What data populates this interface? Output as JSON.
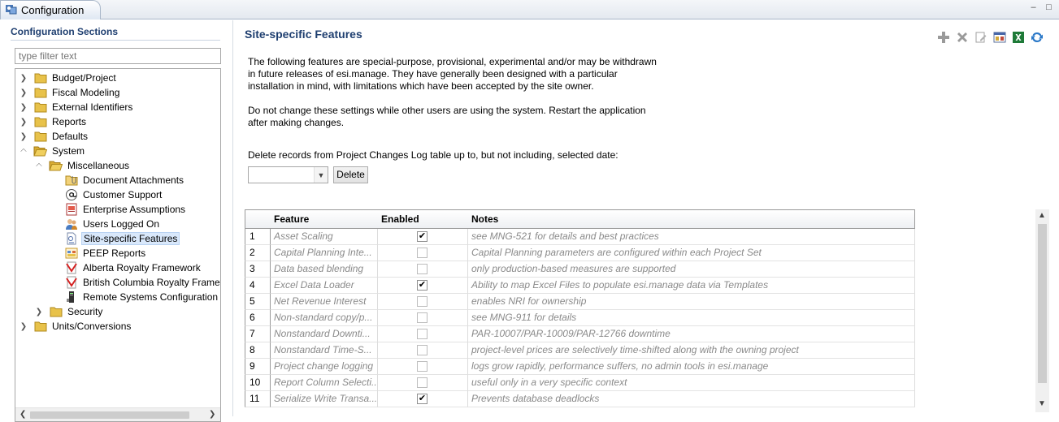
{
  "tab": {
    "title": "Configuration"
  },
  "left": {
    "section_title": "Configuration Sections",
    "filter_placeholder": "type filter text",
    "tree": [
      {
        "label": "Budget/Project",
        "icon": "folder-icon",
        "level": 0,
        "expander": "collapsed"
      },
      {
        "label": "Fiscal Modeling",
        "icon": "folder-icon",
        "level": 0,
        "expander": "collapsed"
      },
      {
        "label": "External Identifiers",
        "icon": "folder-icon",
        "level": 0,
        "expander": "collapsed"
      },
      {
        "label": "Reports",
        "icon": "folder-icon",
        "level": 0,
        "expander": "collapsed"
      },
      {
        "label": "Defaults",
        "icon": "folder-icon",
        "level": 0,
        "expander": "collapsed"
      },
      {
        "label": "System",
        "icon": "folder-open-icon",
        "level": 0,
        "expander": "expanded"
      },
      {
        "label": "Miscellaneous",
        "icon": "folder-open-icon",
        "level": 1,
        "expander": "expanded"
      },
      {
        "label": "Document Attachments",
        "icon": "attachment-folder-icon",
        "level": 2,
        "expander": "none"
      },
      {
        "label": "Customer Support",
        "icon": "at-sign-icon",
        "level": 2,
        "expander": "none"
      },
      {
        "label": "Enterprise Assumptions",
        "icon": "assumptions-icon",
        "level": 2,
        "expander": "none"
      },
      {
        "label": "Users Logged On",
        "icon": "users-icon",
        "level": 2,
        "expander": "none"
      },
      {
        "label": "Site-specific Features",
        "icon": "document-icon",
        "level": 2,
        "expander": "none",
        "selected": true
      },
      {
        "label": "PEEP Reports",
        "icon": "report-icon",
        "level": 2,
        "expander": "none"
      },
      {
        "label": "Alberta Royalty Framework",
        "icon": "royalty-icon",
        "level": 2,
        "expander": "none"
      },
      {
        "label": "British Columbia Royalty Framew",
        "icon": "royalty-icon",
        "level": 2,
        "expander": "none"
      },
      {
        "label": "Remote Systems Configuration",
        "icon": "remote-system-icon",
        "level": 2,
        "expander": "none"
      },
      {
        "label": "Security",
        "icon": "folder-icon",
        "level": 1,
        "expander": "collapsed"
      },
      {
        "label": "Units/Conversions",
        "icon": "folder-icon",
        "level": 0,
        "expander": "collapsed"
      }
    ]
  },
  "main": {
    "title": "Site-specific Features",
    "toolbar": [
      "add-icon",
      "delete-icon",
      "edit-icon",
      "properties-icon",
      "excel-export-icon",
      "refresh-icon"
    ],
    "intro_lines": [
      "The following features are special-purpose, provisional, experimental and/or may be withdrawn",
      "in future releases of esi.manage.  They have generally been designed with a particular",
      "installation in mind, with limitations which have been accepted by the site owner."
    ],
    "warning_lines": [
      "Do not change these settings while other users are using the system.  Restart the application",
      "after making changes."
    ],
    "delete_prompt": "Delete records from Project Changes Log table up to, but not including, selected date:",
    "date_value": "",
    "delete_label": "Delete",
    "table": {
      "headers": {
        "feature": "Feature",
        "enabled": "Enabled",
        "notes": "Notes"
      },
      "rows": [
        {
          "num": "1",
          "feature": "Asset Scaling",
          "enabled": true,
          "notes": "see MNG-521 for details and best practices"
        },
        {
          "num": "2",
          "feature": "Capital Planning Inte...",
          "enabled": false,
          "notes": "Capital Planning parameters are configured within each Project Set"
        },
        {
          "num": "3",
          "feature": "Data based blending",
          "enabled": false,
          "notes": "only production-based measures are supported"
        },
        {
          "num": "4",
          "feature": "Excel Data Loader",
          "enabled": true,
          "notes": "Ability to map Excel Files to populate esi.manage data via Templates"
        },
        {
          "num": "5",
          "feature": "Net Revenue Interest",
          "enabled": false,
          "notes": "enables NRI for ownership"
        },
        {
          "num": "6",
          "feature": "Non-standard copy/p...",
          "enabled": false,
          "notes": "see MNG-911 for details"
        },
        {
          "num": "7",
          "feature": "Nonstandard Downti...",
          "enabled": false,
          "notes": "PAR-10007/PAR-10009/PAR-12766 downtime"
        },
        {
          "num": "8",
          "feature": "Nonstandard Time-S...",
          "enabled": false,
          "notes": "project-level prices are selectively time-shifted along with the owning project"
        },
        {
          "num": "9",
          "feature": "Project change logging",
          "enabled": false,
          "notes": "logs grow rapidly, performance suffers, no admin tools in esi.manage"
        },
        {
          "num": "10",
          "feature": "Report Column Selecti...",
          "enabled": false,
          "notes": "useful only in a very specific context"
        },
        {
          "num": "11",
          "feature": "Serialize Write Transa...",
          "enabled": true,
          "notes": "Prevents database deadlocks"
        }
      ]
    }
  }
}
